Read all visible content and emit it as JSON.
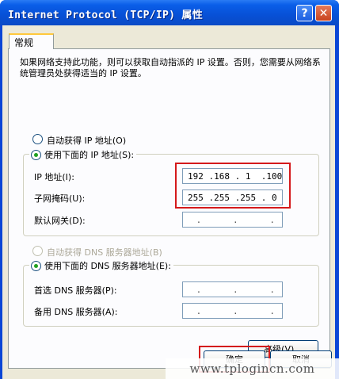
{
  "window": {
    "title": "Internet Protocol (TCP/IP) 属性",
    "help_label": "?",
    "close_label": "✕"
  },
  "tab": {
    "label": "常规"
  },
  "description": "如果网络支持此功能，则可以获取自动指派的 IP 设置。否则，您需要从网络系统管理员处获得适当的 IP 设置。",
  "ip": {
    "auto_label": "自动获得 IP 地址(O)",
    "manual_label": "使用下面的 IP 地址(S):",
    "selected": "manual",
    "address_label": "IP 地址(I):",
    "address_value": "192 .168 . 1  .100",
    "mask_label": "子网掩码(U):",
    "mask_value": "255 .255 .255 . 0",
    "gateway_label": "默认网关(D):",
    "gateway_value": " .      .      . "
  },
  "dns": {
    "auto_label": "自动获得 DNS 服务器地址(B)",
    "manual_label": "使用下面的 DNS 服务器地址(E):",
    "selected": "manual",
    "preferred_label": "首选 DNS 服务器(P):",
    "preferred_value": " .      .      . ",
    "alternate_label": "备用 DNS 服务器(A):",
    "alternate_value": " .      .      . "
  },
  "buttons": {
    "advanced": "高级(V)...",
    "ok": "确定",
    "cancel": "取消"
  },
  "highlight_color": "#d4191b",
  "watermark": "www.tplogincn.com"
}
